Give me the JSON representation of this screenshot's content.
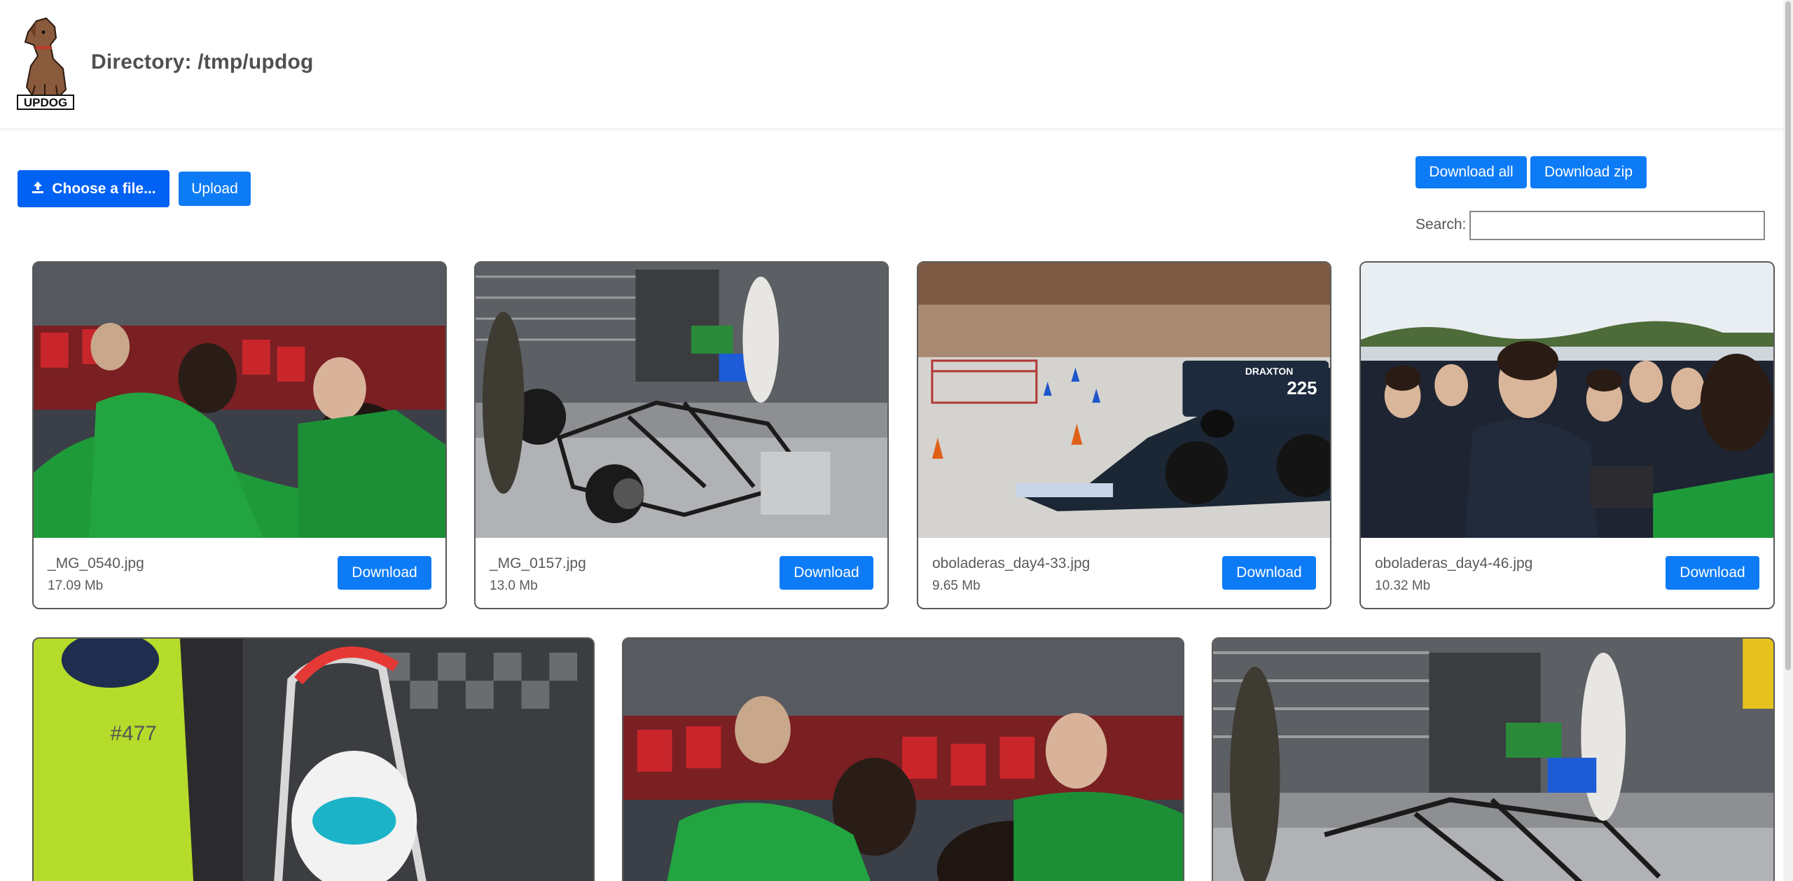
{
  "header": {
    "logo_text": "UPDOG",
    "directory_title": "Directory: /tmp/updog"
  },
  "toolbar": {
    "choose_file_label": "Choose a file...",
    "upload_label": "Upload",
    "download_all_label": "Download all",
    "download_zip_label": "Download zip",
    "search_label": "Search:",
    "search_value": ""
  },
  "files": [
    {
      "name": "_MG_0540.jpg",
      "size": "17.09 Mb",
      "download_label": "Download"
    },
    {
      "name": "_MG_0157.jpg",
      "size": "13.0 Mb",
      "download_label": "Download"
    },
    {
      "name": "oboladeras_day4-33.jpg",
      "size": "9.65 Mb",
      "download_label": "Download"
    },
    {
      "name": "oboladeras_day4-46.jpg",
      "size": "10.32 Mb",
      "download_label": "Download"
    },
    {
      "name": "",
      "size": "",
      "download_label": ""
    },
    {
      "name": "",
      "size": "",
      "download_label": ""
    },
    {
      "name": "",
      "size": "",
      "download_label": ""
    }
  ],
  "colors": {
    "accent": "#0d7bf6",
    "choose_button": "#0061f5",
    "team_green": "#1f9a3a"
  }
}
